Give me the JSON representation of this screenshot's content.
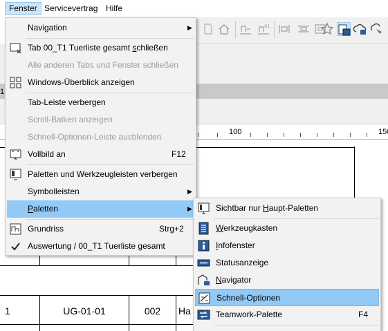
{
  "menubar": {
    "items": [
      {
        "label": "Fenster"
      },
      {
        "label": "Servicevertrag"
      },
      {
        "label": "Hilfe"
      }
    ]
  },
  "toolbar": {
    "icons": [
      "page-icon",
      "home-icon",
      "arrange-icon",
      "arrange-a1-icon",
      "split-vertical-icon",
      "split-horizontal-icon",
      "fit-icon",
      "star-icon",
      "layout-window-icon",
      "navigator-cloud-icon",
      "tag-cloud-icon"
    ]
  },
  "workspace": {
    "left_number": "1"
  },
  "ruler": {
    "labels": [
      "100",
      "150"
    ]
  },
  "table": {
    "row": [
      "1",
      "UG-01-01",
      "002",
      "Ha"
    ]
  },
  "fenster_menu": {
    "items": [
      {
        "label": "Navigation",
        "submenu": true
      },
      {
        "label_pre": "Tab 00_T1 Tuerliste gesamt ",
        "label_ul": "s",
        "label_post": "chließen",
        "icon": "close-window-icon"
      },
      {
        "label": "Alle anderen Tabs und Fenster schließen",
        "disabled": true
      },
      {
        "label": "Windows-Überblick anzeigen",
        "icon": "tiles-icon"
      },
      {
        "label": "Tab-Leiste verbergen"
      },
      {
        "label": "Scroll-Balken anzeigen",
        "disabled": true
      },
      {
        "label": "Schnell-Optionen-Leiste ausblenden",
        "disabled": true
      },
      {
        "label": "Vollbild an",
        "shortcut": "F12",
        "icon": "fullscreen-icon"
      },
      {
        "label": "Paletten und Werkzeugleisten verbergen",
        "icon": "hide-palettes-icon"
      },
      {
        "label": "Symbolleisten",
        "submenu": true
      },
      {
        "label_ul": "P",
        "label_post": "aletten",
        "submenu": true,
        "highlighted": true
      },
      {
        "label": "Grundriss",
        "shortcut": "Strg+2",
        "icon": "floorplan-icon"
      },
      {
        "label": "Auswertung / 00_T1 Tuerliste gesamt",
        "icon": "checkmark-icon"
      }
    ]
  },
  "paletten_menu": {
    "items": [
      {
        "label_pre": "Sichtbar nur ",
        "label_ul": "H",
        "label_post": "aupt-Paletten",
        "icon": "main-palettes-icon"
      },
      {
        "label_ul": "W",
        "label_post": "erkzeugkasten",
        "icon": "toolbox-icon"
      },
      {
        "label_ul": "I",
        "label_post": "nfofenster",
        "icon": "info-icon"
      },
      {
        "label": "Statusanzeige",
        "icon": "status-bar-icon"
      },
      {
        "label_ul": "N",
        "label_post": "avigator",
        "icon": "navigator-icon"
      },
      {
        "label": "Schnell-Optionen",
        "highlighted": true,
        "icon": "quick-options-icon"
      },
      {
        "label": "Teamwork-Palette",
        "shortcut": "F4",
        "icon": "teamwork-icon"
      }
    ]
  }
}
